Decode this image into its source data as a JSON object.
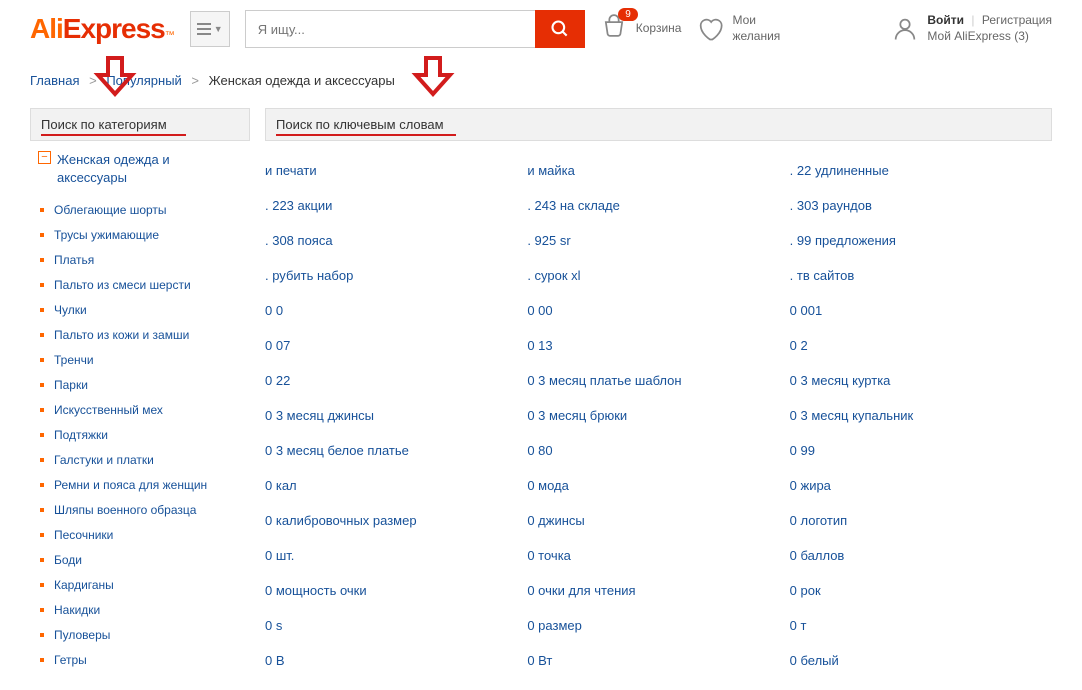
{
  "header": {
    "logo_ali": "Ali",
    "logo_express": "Express",
    "logo_tm": "™",
    "search_placeholder": "Я ищу...",
    "cart_count": "9",
    "cart_label": "Корзина",
    "wishlist_line1": "Мои",
    "wishlist_line2": "желания",
    "login": "Войти",
    "register": "Регистрация",
    "my_ali": "Мой AliExpress (3)"
  },
  "breadcrumb": {
    "home": "Главная",
    "popular": "Популярный",
    "current": "Женская одежда и аксессуары"
  },
  "sidebar": {
    "header": "Поиск по категориям",
    "root": "Женская одежда и аксессуары",
    "items": [
      "Облегающие шорты",
      "Трусы ужимающие",
      "Платья",
      "Пальто из смеси шерсти",
      "Чулки",
      "Пальто из кожи и замши",
      "Тренчи",
      "Парки",
      "Искусственный мех",
      "Подтяжки",
      "Галстуки и платки",
      "Ремни и пояса для женщин",
      "Шляпы военного образца",
      "Песочники",
      "Боди",
      "Кардиганы",
      "Накидки",
      "Пуловеры",
      "Гетры"
    ]
  },
  "main": {
    "header": "Поиск по ключевым словам",
    "rows": [
      [
        "и печати",
        "и майка",
        ". 22 удлиненные"
      ],
      [
        ". 223 акции",
        ". 243 на складе",
        ". 303 раундов"
      ],
      [
        ". 308 пояса",
        ". 925 sr",
        ". 99 предложения"
      ],
      [
        ". рубить набор",
        ". сурок xl",
        ". тв сайтов"
      ],
      [
        "0 0",
        "0 00",
        "0 001"
      ],
      [
        "0 07",
        "0 13",
        "0 2"
      ],
      [
        "0 22",
        "0 3 месяц платье шаблон",
        "0 3 месяц куртка"
      ],
      [
        "0 3 месяц джинсы",
        "0 3 месяц брюки",
        "0 3 месяц купальник"
      ],
      [
        "0 3 месяц белое платье",
        "0 80",
        "0 99"
      ],
      [
        "0 кал",
        "0 мода",
        "0 жира"
      ],
      [
        "0 калибровочных размер",
        "0 джинсы",
        "0 логотип"
      ],
      [
        "0 шт.",
        "0 точка",
        "0 баллов"
      ],
      [
        "0 мощность очки",
        "0 очки для чтения",
        "0 рок"
      ],
      [
        "0 s",
        "0 размер",
        "0 т"
      ],
      [
        "0 В",
        "0 Вт",
        "0 белый"
      ]
    ]
  }
}
